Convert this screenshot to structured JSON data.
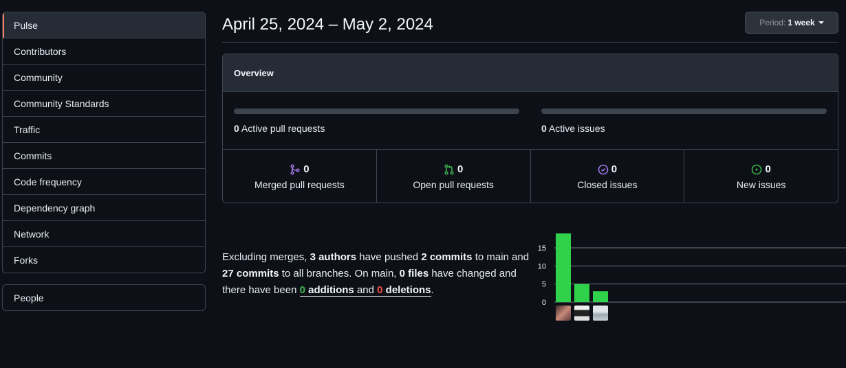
{
  "sidebar": {
    "items": [
      {
        "label": "Pulse"
      },
      {
        "label": "Contributors"
      },
      {
        "label": "Community"
      },
      {
        "label": "Community Standards"
      },
      {
        "label": "Traffic"
      },
      {
        "label": "Commits"
      },
      {
        "label": "Code frequency"
      },
      {
        "label": "Dependency graph"
      },
      {
        "label": "Network"
      },
      {
        "label": "Forks"
      }
    ],
    "people_label": "People",
    "selected_accent": "#f78166"
  },
  "header": {
    "date_range": "April 25, 2024 – May 2, 2024",
    "period_prefix": "Period:",
    "period_value": "1 week"
  },
  "overview": {
    "title": "Overview",
    "active_prs_count": "0",
    "active_prs_label": "Active pull requests",
    "active_issues_count": "0",
    "active_issues_label": "Active issues",
    "stats": [
      {
        "count": "0",
        "label": "Merged pull requests",
        "icon": "git-merge-icon",
        "color": "#ab7df8"
      },
      {
        "count": "0",
        "label": "Open pull requests",
        "icon": "git-pull-request-icon",
        "color": "#3fb950"
      },
      {
        "count": "0",
        "label": "Closed issues",
        "icon": "issue-closed-icon",
        "color": "#ab7df8"
      },
      {
        "count": "0",
        "label": "New issues",
        "icon": "issue-opened-icon",
        "color": "#3fb950"
      }
    ]
  },
  "summary": {
    "t1": "Excluding merges, ",
    "authors": "3 authors",
    "t2": " have pushed ",
    "commits_main": "2 commits",
    "t3": " to main and ",
    "commits_all": "27 commits",
    "t4": " to all branches. On main, ",
    "files": "0 files",
    "t5": " have changed and there have been ",
    "additions_count": "0",
    "additions_word": " additions",
    "and": " and ",
    "deletions_count": "0",
    "deletions_word": " deletions",
    "t6": "."
  },
  "chart_data": {
    "type": "bar",
    "categories": [
      "author-1",
      "author-2",
      "author-3"
    ],
    "values": [
      19,
      5,
      3
    ],
    "yticks": [
      0,
      5,
      10,
      15
    ],
    "ylim": [
      0,
      19
    ],
    "bar_color": "#2ea043",
    "title": "",
    "xlabel": "",
    "ylabel": ""
  }
}
